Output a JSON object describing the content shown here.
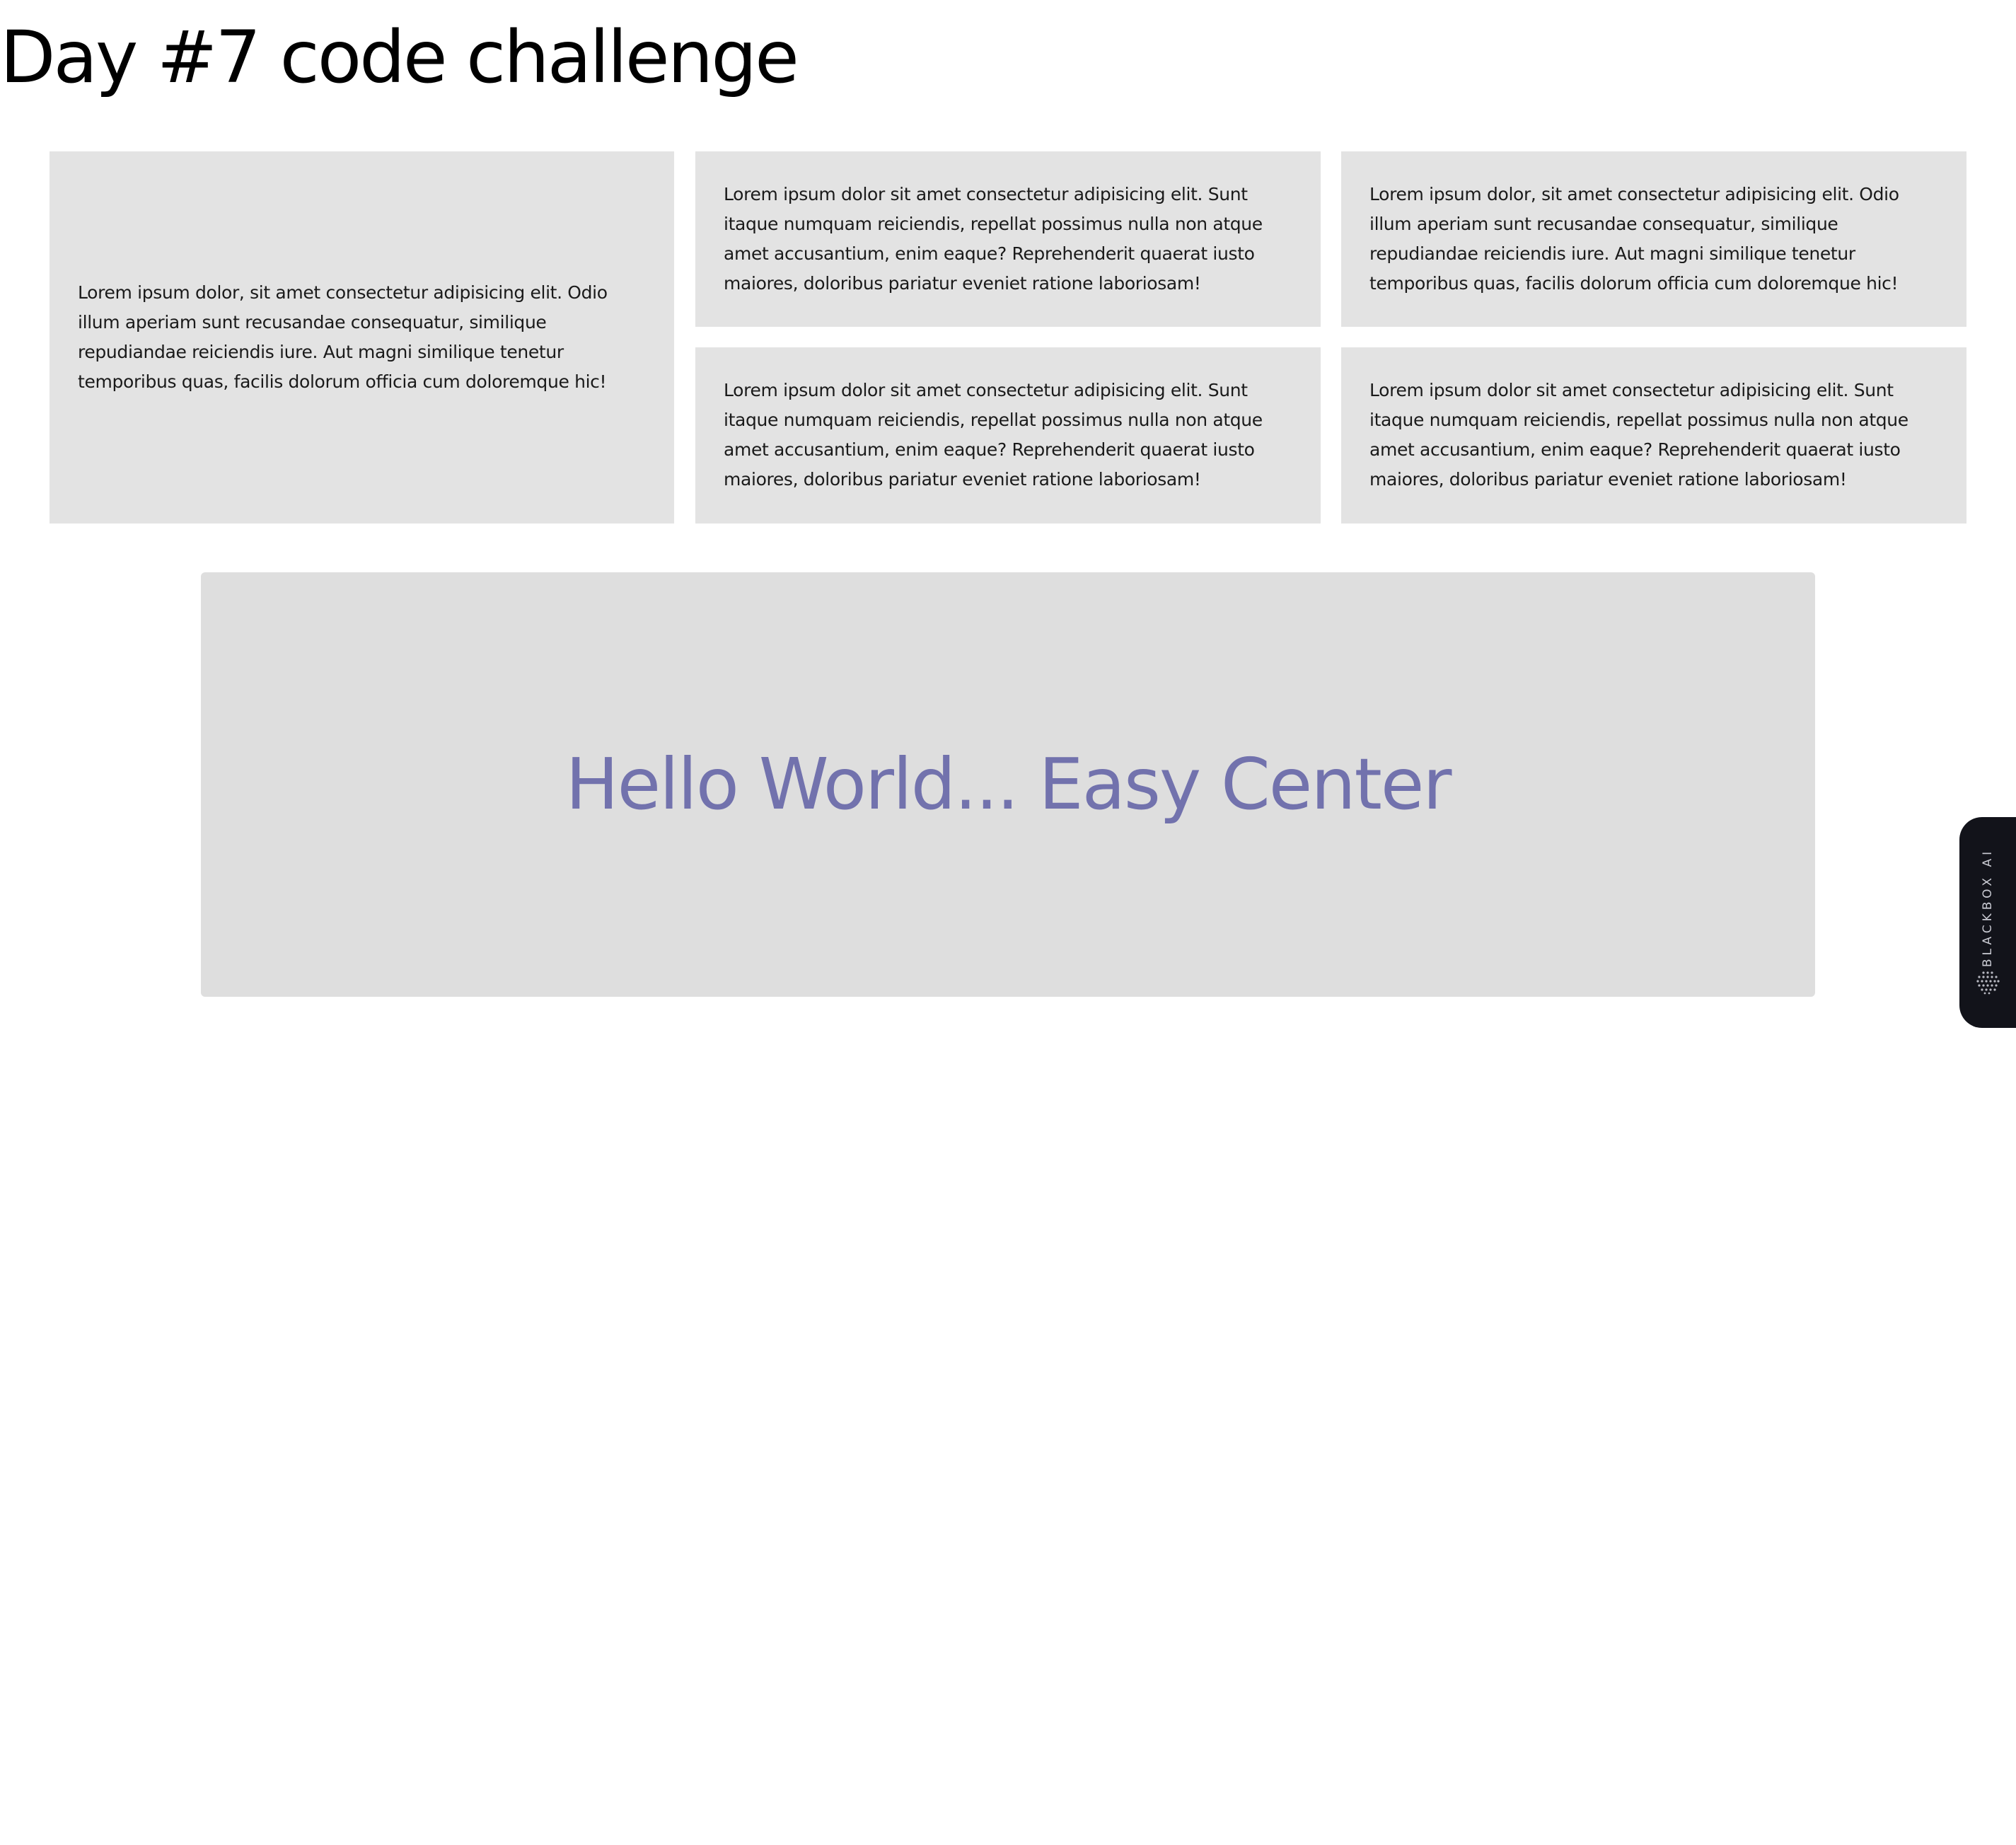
{
  "page": {
    "title": "Day #7 code challenge"
  },
  "grid": {
    "cards": [
      {
        "text": "Lorem ipsum dolor, sit amet consectetur adipisicing elit. Odio illum aperiam sunt recusandae consequatur, similique repudiandae reiciendis iure. Aut magni similique tenetur temporibus quas, facilis dolorum officia cum doloremque hic!"
      },
      {
        "text": "Lorem ipsum dolor sit amet consectetur adipisicing elit. Sunt itaque numquam reiciendis, repellat possimus nulla non atque amet accusantium, enim eaque? Reprehenderit quaerat iusto maiores, doloribus pariatur eveniet ratione laboriosam!"
      },
      {
        "text": "Lorem ipsum dolor, sit amet consectetur adipisicing elit. Odio illum aperiam sunt recusandae consequatur, similique repudiandae reiciendis iure. Aut magni similique tenetur temporibus quas, facilis dolorum officia cum doloremque hic!"
      },
      {
        "text": "Lorem ipsum dolor sit amet consectetur adipisicing elit. Sunt itaque numquam reiciendis, repellat possimus nulla non atque amet accusantium, enim eaque? Reprehenderit quaerat iusto maiores, doloribus pariatur eveniet ratione laboriosam!"
      },
      {
        "text": "Lorem ipsum dolor sit amet consectetur adipisicing elit. Sunt itaque numquam reiciendis, repellat possimus nulla non atque amet accusantium, enim eaque? Reprehenderit quaerat iusto maiores, doloribus pariatur eveniet ratione laboriosam!"
      }
    ]
  },
  "center_box": {
    "text": "Hello World... Easy Center"
  },
  "side_widget": {
    "label": "BLACKBOX AI",
    "icon": "blackbox-logo-icon"
  },
  "colors": {
    "card_background": "#e3e3e3",
    "center_background": "#dedede",
    "center_text": "#7272ad",
    "widget_background": "#12131a"
  }
}
